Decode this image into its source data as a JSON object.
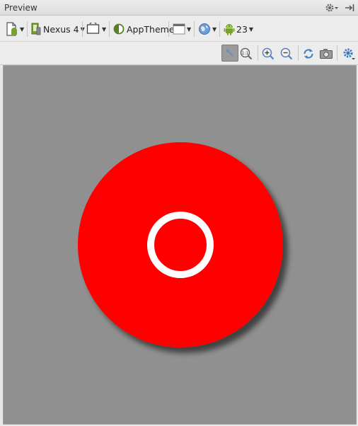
{
  "panel": {
    "title": "Preview"
  },
  "toolbar": {
    "device": "Nexus 4",
    "theme": "AppTheme",
    "api_level": "23"
  },
  "zoom_actual_size_label": "1:1",
  "colors": {
    "canvas": "#909090",
    "fab": "#ff0000",
    "ring": "#ffffff",
    "android_green": "#78a22f"
  },
  "icons": {
    "titlebar": [
      "gear-icon",
      "pin-icon"
    ],
    "toolbar1": [
      "virtual-device-icon",
      "device-icon",
      "orientation-icon",
      "theme-icon",
      "activity-layout-icon",
      "locale-globe-icon",
      "android-icon"
    ],
    "toolbar2": [
      "zoom-to-fit-icon",
      "actual-size-icon",
      "zoom-in-icon",
      "zoom-out-icon",
      "refresh-icon",
      "screenshot-icon",
      "settings-icon"
    ]
  }
}
